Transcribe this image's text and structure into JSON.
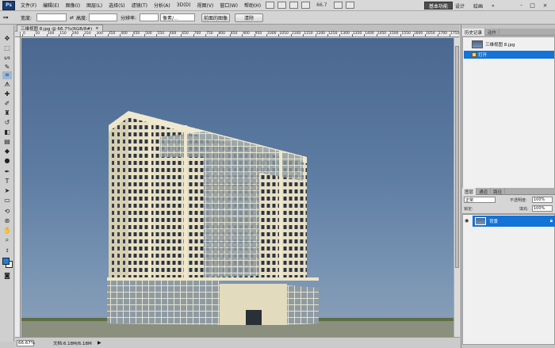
{
  "app": {
    "logo": "Ps",
    "menu": [
      "文件(F)",
      "编辑(E)",
      "图像(I)",
      "图层(L)",
      "选择(S)",
      "滤镜(T)",
      "分析(A)",
      "3D(D)",
      "视图(V)",
      "窗口(W)",
      "帮助(H)"
    ],
    "zoom": "66.7",
    "workspace": {
      "active": "基本功能",
      "items": [
        "设计",
        "绘画"
      ],
      "more": "»"
    },
    "window_controls": [
      "-",
      "□",
      "×"
    ]
  },
  "options": {
    "width_label": "宽度:",
    "height_label": "高度:",
    "resolution_label": "分辨率:",
    "resolution_unit": "像素/...",
    "front_image_button": "前面的图像",
    "clear_button": "清除",
    "swap_symbol": "⇄"
  },
  "document": {
    "tab_title": "三维视图 8.jpg @ 66.7%(RGB/8#)",
    "tab_close": "×",
    "ruler_labels": [
      "0",
      "50",
      "100",
      "150",
      "200",
      "250",
      "300",
      "350",
      "400",
      "450",
      "500",
      "550",
      "600",
      "650",
      "700",
      "750",
      "800",
      "850",
      "900",
      "950",
      "1000",
      "1050",
      "1100",
      "1150",
      "1200",
      "1250",
      "1300",
      "1350",
      "1400",
      "1450",
      "1500",
      "1550",
      "1600",
      "1650",
      "1700",
      "1750"
    ]
  },
  "status": {
    "zoom": "66.67%",
    "doc_info": "文档:6.18M/6.18M",
    "arrow": "▶"
  },
  "history_panel": {
    "tabs": [
      "历史记录",
      "动作"
    ],
    "snapshot": "三维视图 8.jpg",
    "step": "打开"
  },
  "layers_panel": {
    "tabs": [
      "图层",
      "通道",
      "路径"
    ],
    "blend_mode": "正常",
    "opacity_label": "不透明度:",
    "opacity_value": "100%",
    "lock_label": "锁定:",
    "fill_label": "填充:",
    "fill_value": "100%",
    "layer_name": "背景"
  },
  "colors": {
    "foreground": "#1e7ee0",
    "background": "#ffffff",
    "selection": "#1473d6"
  }
}
